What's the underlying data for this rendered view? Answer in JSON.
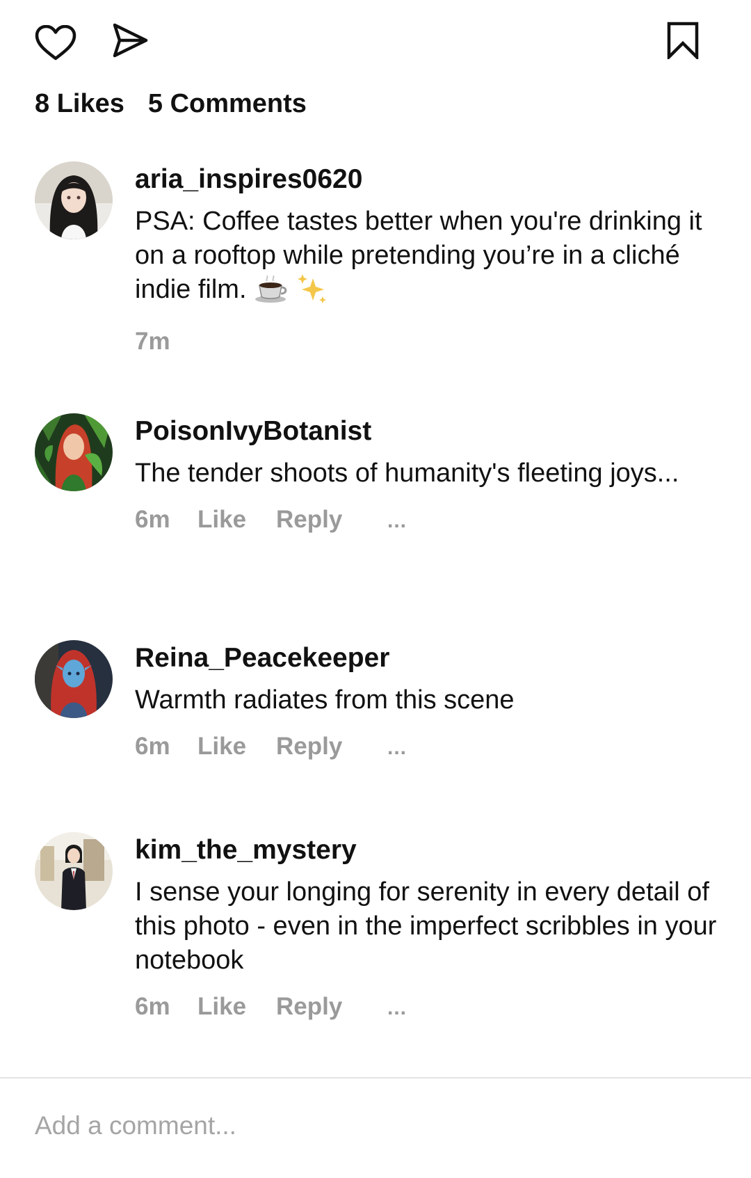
{
  "actions": {
    "like_icon": "heart-outline-icon",
    "share_icon": "send-icon",
    "bookmark_icon": "bookmark-outline-icon"
  },
  "stats": {
    "likes": "8 Likes",
    "comments": "5 Comments"
  },
  "comments": [
    {
      "username": "aria_inspires0620",
      "text": "PSA: Coffee tastes better when you're drinking it on a rooftop while pretending you’re in a cliché indie film.",
      "emojis": [
        "coffee-cup-icon",
        "sparkles-icon"
      ],
      "time": "7m"
    },
    {
      "username": "PoisonIvyBotanist",
      "text": "The tender shoots of humanity's fleeting joys...",
      "time": "6m",
      "like_label": "Like",
      "reply_label": "Reply",
      "more_label": "..."
    },
    {
      "username": "Reina_Peacekeeper",
      "text": "Warmth radiates from this scene",
      "time": "6m",
      "like_label": "Like",
      "reply_label": "Reply",
      "more_label": "..."
    },
    {
      "username": "kim_the_mystery",
      "text": "I sense your longing for serenity in every detail of this photo - even in the imperfect scribbles in your notebook",
      "time": "6m",
      "like_label": "Like",
      "reply_label": "Reply",
      "more_label": "..."
    }
  ],
  "composer": {
    "placeholder": "Add a comment..."
  },
  "colors": {
    "text": "#111111",
    "meta": "#9a9a9a",
    "placeholder": "#a5a5a5",
    "divider": "#e4e4e4"
  }
}
